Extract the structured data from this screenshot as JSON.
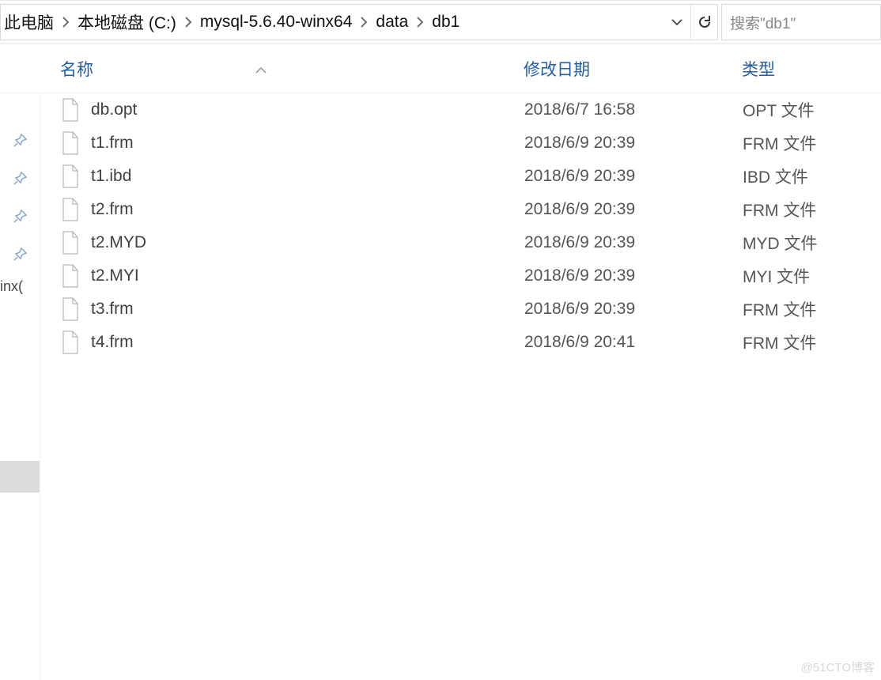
{
  "breadcrumb": {
    "items": [
      {
        "label": "此电脑"
      },
      {
        "label": "本地磁盘 (C:)"
      },
      {
        "label": "mysql-5.6.40-winx64"
      },
      {
        "label": "data"
      },
      {
        "label": "db1"
      }
    ]
  },
  "search": {
    "placeholder": "搜索\"db1\""
  },
  "columns": {
    "name": "名称",
    "date": "修改日期",
    "type": "类型"
  },
  "sidebar": {
    "truncated_label": "inx("
  },
  "files": [
    {
      "name": "db.opt",
      "date": "2018/6/7 16:58",
      "type": "OPT 文件"
    },
    {
      "name": "t1.frm",
      "date": "2018/6/9 20:39",
      "type": "FRM 文件"
    },
    {
      "name": "t1.ibd",
      "date": "2018/6/9 20:39",
      "type": "IBD 文件"
    },
    {
      "name": "t2.frm",
      "date": "2018/6/9 20:39",
      "type": "FRM 文件"
    },
    {
      "name": "t2.MYD",
      "date": "2018/6/9 20:39",
      "type": "MYD 文件"
    },
    {
      "name": "t2.MYI",
      "date": "2018/6/9 20:39",
      "type": "MYI 文件"
    },
    {
      "name": "t3.frm",
      "date": "2018/6/9 20:39",
      "type": "FRM 文件"
    },
    {
      "name": "t4.frm",
      "date": "2018/6/9 20:41",
      "type": "FRM 文件"
    }
  ],
  "watermark": "@51CTO博客"
}
